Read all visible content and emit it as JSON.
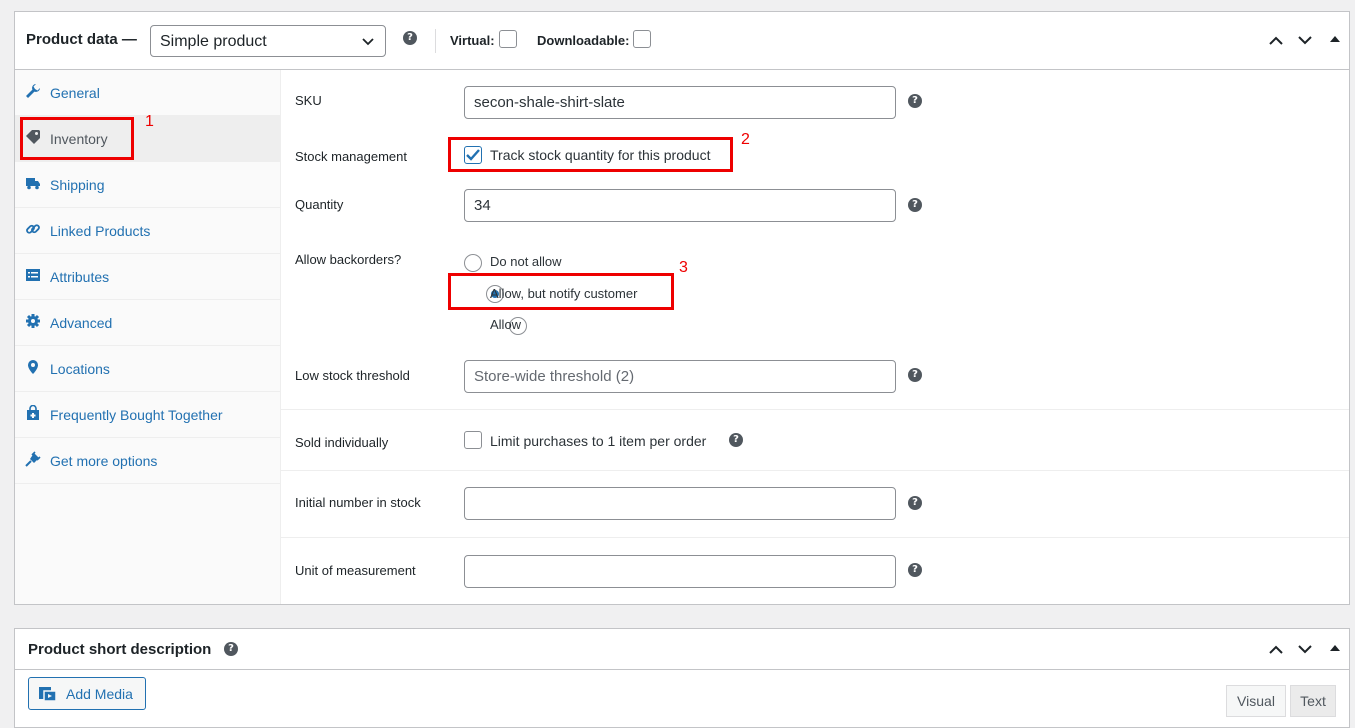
{
  "product_data": {
    "title": "Product data —",
    "product_type": "Simple product",
    "virtual_label": "Virtual:",
    "downloadable_label": "Downloadable:"
  },
  "tabs": [
    {
      "label": "General",
      "icon": "wrench-icon"
    },
    {
      "label": "Inventory",
      "icon": "tag-icon"
    },
    {
      "label": "Shipping",
      "icon": "truck-icon"
    },
    {
      "label": "Linked Products",
      "icon": "link-icon"
    },
    {
      "label": "Attributes",
      "icon": "list-icon"
    },
    {
      "label": "Advanced",
      "icon": "gear-icon"
    },
    {
      "label": "Locations",
      "icon": "location-pin-icon"
    },
    {
      "label": "Frequently Bought Together",
      "icon": "bag-icon"
    },
    {
      "label": "Get more options",
      "icon": "plugin-icon"
    }
  ],
  "active_tab": "Inventory",
  "inventory": {
    "sku_label": "SKU",
    "sku_value": "secon-shale-shirt-slate",
    "stock_management_label": "Stock management",
    "track_stock_label": "Track stock quantity for this product",
    "track_stock_checked": true,
    "quantity_label": "Quantity",
    "quantity_value": "34",
    "backorders_label": "Allow backorders?",
    "backorder_options": [
      "Do not allow",
      "Allow, but notify customer",
      "Allow"
    ],
    "backorder_selected": "Allow, but notify customer",
    "low_stock_label": "Low stock threshold",
    "low_stock_placeholder": "Store-wide threshold (2)",
    "sold_individually_label": "Sold individually",
    "limit_purchases_label": "Limit purchases to 1 item per order",
    "initial_stock_label": "Initial number in stock",
    "initial_stock_value": "",
    "unit_label": "Unit of measurement",
    "unit_value": ""
  },
  "annotations": [
    "1",
    "2",
    "3"
  ],
  "short_description": {
    "title": "Product short description",
    "add_media_label": "Add Media",
    "visual_tab": "Visual",
    "text_tab": "Text"
  },
  "colors": {
    "link": "#2271b1",
    "annotation_red": "#ee0000",
    "border": "#c3c4c7"
  }
}
